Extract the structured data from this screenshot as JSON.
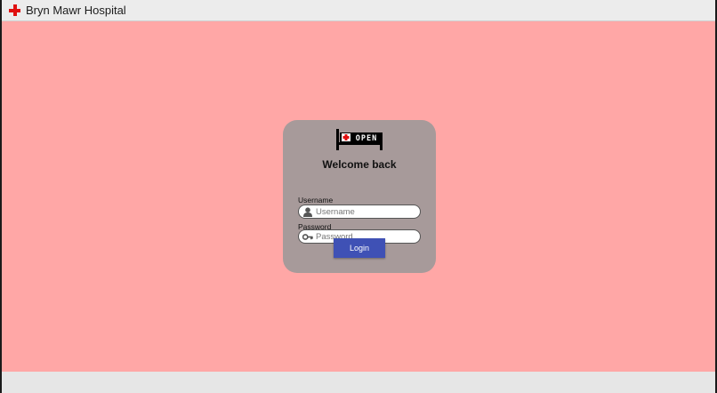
{
  "header": {
    "title": "Bryn Mawr Hospital",
    "logo_icon": "red-cross-icon"
  },
  "login": {
    "brand_icon": "open-bed-logo",
    "brand_text": "OPEN",
    "heading": "Welcome back",
    "username": {
      "label": "Username",
      "placeholder": "Username",
      "value": "",
      "icon": "user-icon"
    },
    "password": {
      "label": "Password",
      "placeholder": "Password",
      "value": "",
      "icon": "key-icon"
    },
    "submit_label": "Login"
  },
  "colors": {
    "background": "#ffa7a6",
    "card": "#a79a9a",
    "button": "#3f51b5",
    "cross": "#e01010"
  }
}
